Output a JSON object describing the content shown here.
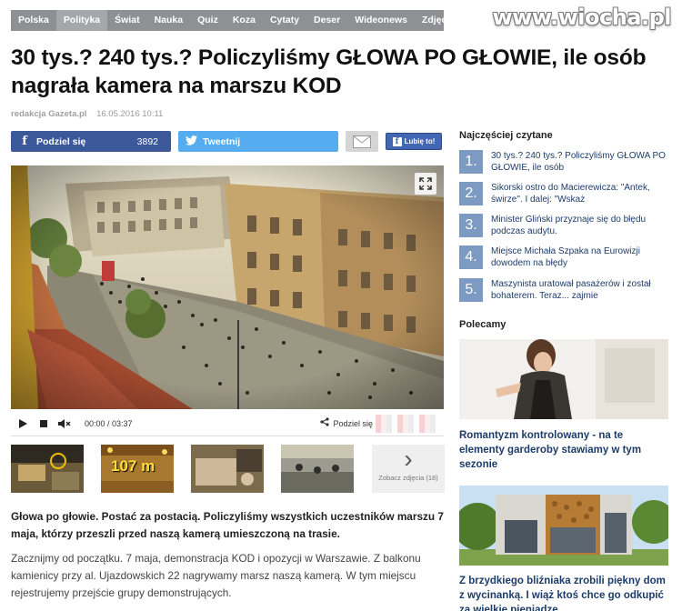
{
  "nav": {
    "items": [
      "Polska",
      "Polityka",
      "Świat",
      "Nauka",
      "Quiz",
      "Koza",
      "Cytaty",
      "Deser",
      "Wideonews",
      "Zdjęcia"
    ],
    "active": "Polityka"
  },
  "watermark": "www.wiocha.pl",
  "article": {
    "title": "30 tys.? 240 tys.? Policzyliśmy GŁOWA PO GŁOWIE, ile osób nagrała kamera na marszu KOD",
    "author": "redakcja Gazeta.pl",
    "date": "16.05.2016 10:11",
    "lead": "Głowa po głowie. Postać za postacią. Policzyliśmy wszystkich uczestników marszu 7 maja, którzy przeszli przed naszą kamerą umieszczoną na trasie.",
    "body": "Zacznijmy od początku. 7 maja, demonstracja KOD i opozycji w Warszawie. Z balkonu kamienicy przy al. Ujazdowskich 22 nagrywamy marsz naszą kamerą. W tym miejscu rejestrujemy przejście grupy demonstrujących."
  },
  "share": {
    "facebook_label": "Podziel się",
    "facebook_count": "3892",
    "twitter_label": "Tweetnij",
    "like_label": "Lubię to!",
    "mail_icon": "mail-icon"
  },
  "video": {
    "time": "00:00 / 03:37",
    "share_label": "Podziel się"
  },
  "thumbnails": {
    "second_label": "107 m",
    "more_label": "Zobacz zdjęcia (18)"
  },
  "sidebar": {
    "most_read_title": "Najczęściej czytane",
    "most_read": [
      {
        "num": "1.",
        "text": "30 tys.? 240 tys.? Policzyliśmy GŁOWA PO GŁOWIE, ile osób"
      },
      {
        "num": "2.",
        "text": "Sikorski ostro do Macierewicza: \"Antek, świrze\". I dalej: \"Wskaż"
      },
      {
        "num": "3.",
        "text": "Minister Gliński przyznaje się do błędu podczas audytu."
      },
      {
        "num": "4.",
        "text": "Miejsce Michała Szpaka na Eurowizji dowodem na błędy"
      },
      {
        "num": "5.",
        "text": "Maszynista uratował pasażerów i został bohaterem. Teraz... zajmie"
      }
    ],
    "recommended_title": "Polecamy",
    "promo1": "Romantyzm kontrolowany - na te elementy garderoby stawiamy w tym sezonie",
    "promo2": "Z brzydkiego bliźniaka zrobili piękny dom z wycinanką. I wiąż ktoś chce go odkupić za wielkie pieniądze"
  },
  "colors": {
    "nav_bg": "#8f9093",
    "facebook": "#3b5998",
    "twitter": "#55acee",
    "rank_badge": "#7c9ac2",
    "link": "#1d3c6a"
  }
}
